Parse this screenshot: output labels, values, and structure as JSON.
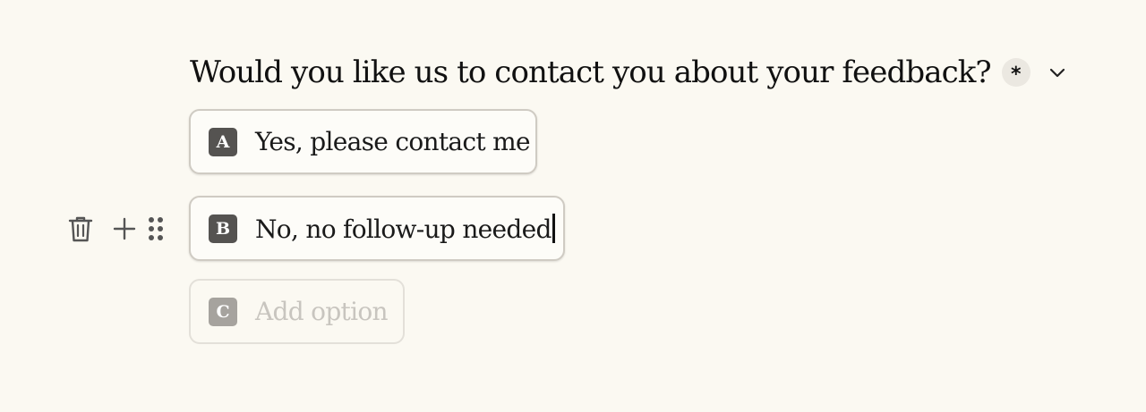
{
  "question": {
    "title": "Would you like us to contact you about your feedback?",
    "required_mark": "*"
  },
  "options": [
    {
      "key": "A",
      "label": "Yes, please contact me"
    },
    {
      "key": "B",
      "label": "No, no follow-up needed"
    },
    {
      "key": "C",
      "placeholder": "Add option"
    }
  ],
  "icons": {
    "delete": "trash-icon",
    "add": "plus-icon",
    "reorder": "drag-handle-icon",
    "collapse": "chevron-down-icon"
  },
  "colors": {
    "background": "#fbf9f2",
    "key_badge": "#555351",
    "key_badge_placeholder": "#a6a39e",
    "placeholder_text": "#c8c5bf"
  }
}
